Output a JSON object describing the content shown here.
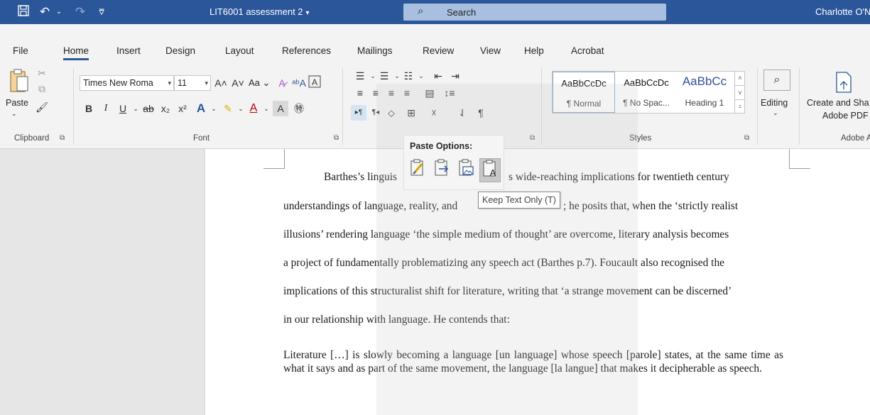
{
  "titlebar": {
    "doc_title": "LIT6001 assessment 2",
    "title_caret": "▾",
    "search_placeholder": "Search",
    "user": "Charlotte O'N"
  },
  "tabs": [
    "File",
    "Home",
    "Insert",
    "Design",
    "Layout",
    "References",
    "Mailings",
    "Review",
    "View",
    "Help",
    "Acrobat"
  ],
  "active_tab": "Home",
  "clipboard": {
    "paste_label": "Paste",
    "group_label": "Clipboard"
  },
  "font": {
    "font_name": "Times New Roma",
    "font_size": "11",
    "change_case": "Aa",
    "group_label": "Font"
  },
  "paragraph": {
    "group_label": ""
  },
  "styles": {
    "items": [
      {
        "preview": "AaBbCcDc",
        "name": "¶ Normal"
      },
      {
        "preview": "AaBbCcDc",
        "name": "¶ No Spac..."
      },
      {
        "preview": "AaBbCc",
        "name": "Heading 1"
      }
    ],
    "group_label": "Styles"
  },
  "editing": {
    "label": "Editing"
  },
  "adobe": {
    "line1": "Create and Sha",
    "line2": "Adobe PDF",
    "group_label": "Adobe A"
  },
  "paste_options": {
    "title": "Paste Options:",
    "tooltip": "Keep Text Only (T)"
  },
  "document": {
    "lines": [
      "Barthes’s linguis",
      "s wide-reaching implications for twentieth century",
      "understandings of language, reality, and",
      "; he posits that, when the ‘strictly realist",
      "illusions’ rendering language ‘the simple medium of thought’ are overcome, literary analysis becomes",
      "a project of fundamentally problematizing any speech act (Barthes p.7). Foucault also recognised the",
      "implications of this structuralist shift for literature, writing that ‘a strange movement can be discerned’",
      "in our relationship with language. He contends that:"
    ],
    "quote": "Literature […] is slowly becoming a language [un language] whose speech [parole] states, at the same time as what it says and as part of the same movement, the language [la langue] that makes it decipherable as speech."
  },
  "colors": {
    "titlebar": "#2b579a",
    "ribbon": "#f3f3f3",
    "accent": "#2b579a"
  }
}
